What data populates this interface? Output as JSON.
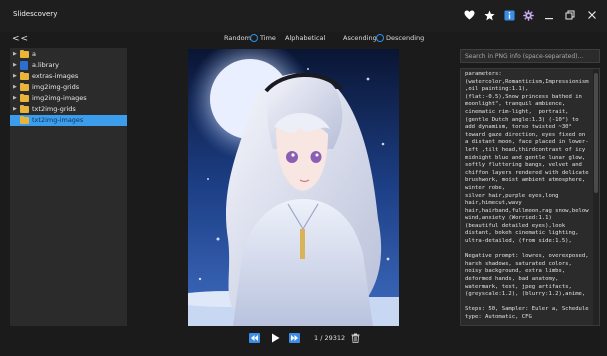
{
  "app": {
    "title": "Slidescovery"
  },
  "nav": {
    "back_label": "<<"
  },
  "sort": {
    "options": [
      {
        "label": "Random",
        "selected": false
      },
      {
        "label": "Time",
        "selected": false
      },
      {
        "label": "Alphabetical",
        "selected": false
      }
    ],
    "order": [
      {
        "label": "Ascending",
        "selected": false
      },
      {
        "label": "Descending",
        "selected": false
      }
    ]
  },
  "tree": {
    "items": [
      {
        "label": "a",
        "type": "folder",
        "expandable": true,
        "selected": false
      },
      {
        "label": "a.library",
        "type": "python-file",
        "expandable": true,
        "selected": false
      },
      {
        "label": "extras-images",
        "type": "folder",
        "expandable": true,
        "selected": false
      },
      {
        "label": "img2img-grids",
        "type": "folder",
        "expandable": true,
        "selected": false
      },
      {
        "label": "img2img-images",
        "type": "folder",
        "expandable": true,
        "selected": false
      },
      {
        "label": "txt2img-grids",
        "type": "folder",
        "expandable": true,
        "selected": false
      },
      {
        "label": "txt2img-images",
        "type": "folder",
        "expandable": false,
        "selected": true
      }
    ]
  },
  "viewer": {
    "counter": "1 / 29312"
  },
  "info": {
    "search_placeholder": "Search in PNG info (space-separated)...",
    "text": "parameters:\n(watercolor,Romanticism,Impressionism,oil painting:1.1),\n(flat:-0.5),Snow princess bathed in moonlight\", tranquil ambience, cinematic rim-light,  portrait, (gentle Dutch angle:1.3) (-10°) to add dynamism, torso twisted ~30° toward gaze direction, eyes fixed on a distant moon, face placed in lower-left ,tilt head,thirdcontrast of icy midnight blue and gentle lunar glow, softly fluttering bangs, velvet and chiffon layers rendered with delicate brushwork, moist ambient atmosphere, winter robe,\nsilver hair,purple eyes,long hair,himecut,wavy hair,hairband,fullmoon,rag snow,below wind,anxiety (Worried:1.1)  (beautiful detailed eyes),look distant, bokeh cinematic lighting, ultra-detailed, (from side:1.5),\n\nNegative prompt: lowres, overexposed, harsh shadows, saturated colors, noisy background, extra limbs, deformed hands, bad anatomy, watermark, text, jpeg artifacts, (greyscale:1.2), (blurry:1.2),anime,\n\nSteps: 50, Sampler: Euler a, Schedule type: Automatic, CFG"
  },
  "colors": {
    "accent": "#3b9dec",
    "folder": "#e8b43a",
    "background": "#1b1b1b",
    "panel": "#2b2b2b"
  }
}
